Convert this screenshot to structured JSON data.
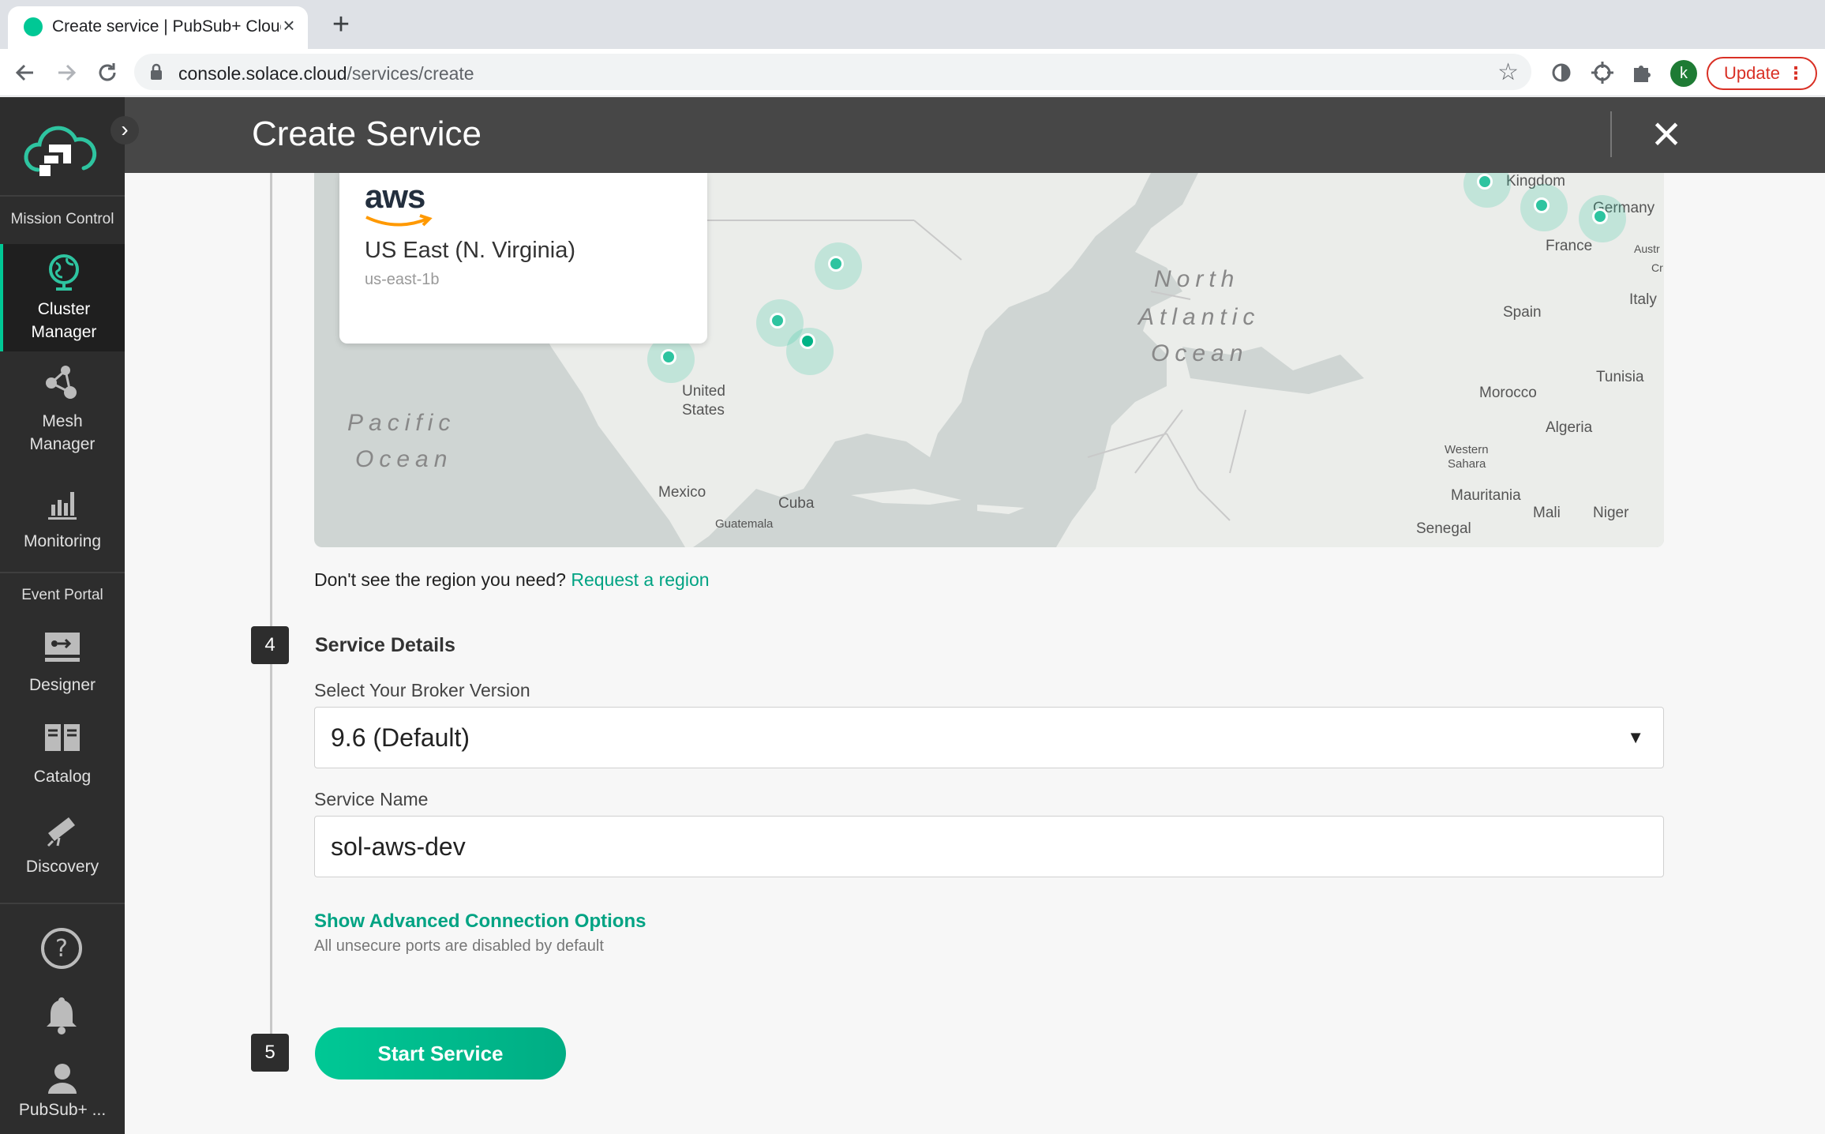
{
  "browser": {
    "tab_title": "Create service | PubSub+ Cloud",
    "tab_close": "×",
    "new_tab": "+",
    "url_host": "console.solace.cloud",
    "url_path": "/services/create",
    "profile_initial": "k",
    "update_label": "Update",
    "colors": {
      "favicon": "#00c895",
      "update": "#d93025",
      "profile": "#1e7b34"
    }
  },
  "sidebar": {
    "sections": {
      "mission_control": "Mission Control",
      "event_portal": "Event Portal"
    },
    "items": [
      {
        "label1": "Cluster",
        "label2": "Manager",
        "icon": "globe-icon",
        "active": true
      },
      {
        "label1": "Mesh",
        "label2": "Manager",
        "icon": "mesh-icon"
      },
      {
        "label1": "Monitoring",
        "icon": "bar-chart-icon"
      },
      {
        "label1": "Designer",
        "icon": "designer-icon"
      },
      {
        "label1": "Catalog",
        "icon": "catalog-icon"
      },
      {
        "label1": "Discovery",
        "icon": "discovery-icon"
      }
    ],
    "account_label": "PubSub+ ...",
    "accent": "#00c895"
  },
  "header": {
    "title": "Create Service"
  },
  "map": {
    "card": {
      "provider": "aws",
      "region_name": "US East (N. Virginia)",
      "region_code": "us-east-1b"
    },
    "labels": {
      "united": "United",
      "states": "States",
      "mexico": "Mexico",
      "cuba": "Cuba",
      "guatemala": "Guatemala",
      "pacific1": "Pacific",
      "pacific2": "Ocean",
      "north": "North",
      "atlantic": "Atlantic",
      "atl_ocean": "Ocean",
      "kingdom": "Kingdom",
      "germany": "Germany",
      "france": "France",
      "austria": "Austr",
      "croatia": "Cr",
      "italy": "Italy",
      "spain": "Spain",
      "tunisia": "Tunisia",
      "morocco": "Morocco",
      "algeria": "Algeria",
      "western": "Western",
      "sahara": "Sahara",
      "mauritania": "Mauritania",
      "mali": "Mali",
      "niger": "Niger",
      "senegal": "Senegal"
    }
  },
  "region_prompt": {
    "text": "Don't see the region you need?",
    "link": "Request a region"
  },
  "step4": {
    "number": "4",
    "title": "Service Details",
    "broker_label": "Select Your Broker Version",
    "broker_value": "9.6 (Default)",
    "name_label": "Service Name",
    "name_value": "sol-aws-dev",
    "advanced_link": "Show Advanced Connection Options",
    "advanced_note": "All unsecure ports are disabled by default"
  },
  "step5": {
    "number": "5",
    "button": "Start Service"
  },
  "accent_color": "#00a383"
}
